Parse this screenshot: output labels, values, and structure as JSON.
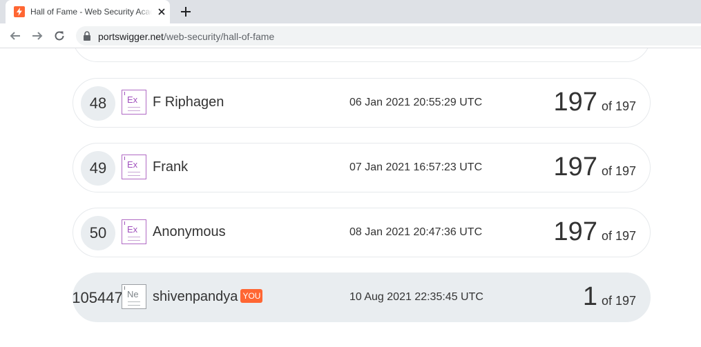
{
  "browser": {
    "tab_title": "Hall of Fame - Web Security Academy",
    "url_domain": "portswigger.net",
    "url_path": "/web-security/hall-of-fame"
  },
  "leaderboard": {
    "rows": [
      {
        "rank": "48",
        "badge": "Ex",
        "name": "F Riphagen",
        "time": "06 Jan 2021 20:55:29 UTC",
        "score": "197",
        "of": "of 197"
      },
      {
        "rank": "49",
        "badge": "Ex",
        "name": "Frank",
        "time": "07 Jan 2021 16:57:23 UTC",
        "score": "197",
        "of": "of 197"
      },
      {
        "rank": "50",
        "badge": "Ex",
        "name": "Anonymous",
        "time": "08 Jan 2021 20:47:36 UTC",
        "score": "197",
        "of": "of 197"
      },
      {
        "rank": "105447",
        "badge": "Ne",
        "name": "shivenpandya",
        "you": "YOU",
        "time": "10 Aug 2021 22:35:45 UTC",
        "score": "1",
        "of": "of 197"
      }
    ]
  },
  "colors": {
    "accent": "#ff6633",
    "badge_expert": "#a04fbd",
    "row_highlight": "#e9edf0"
  }
}
